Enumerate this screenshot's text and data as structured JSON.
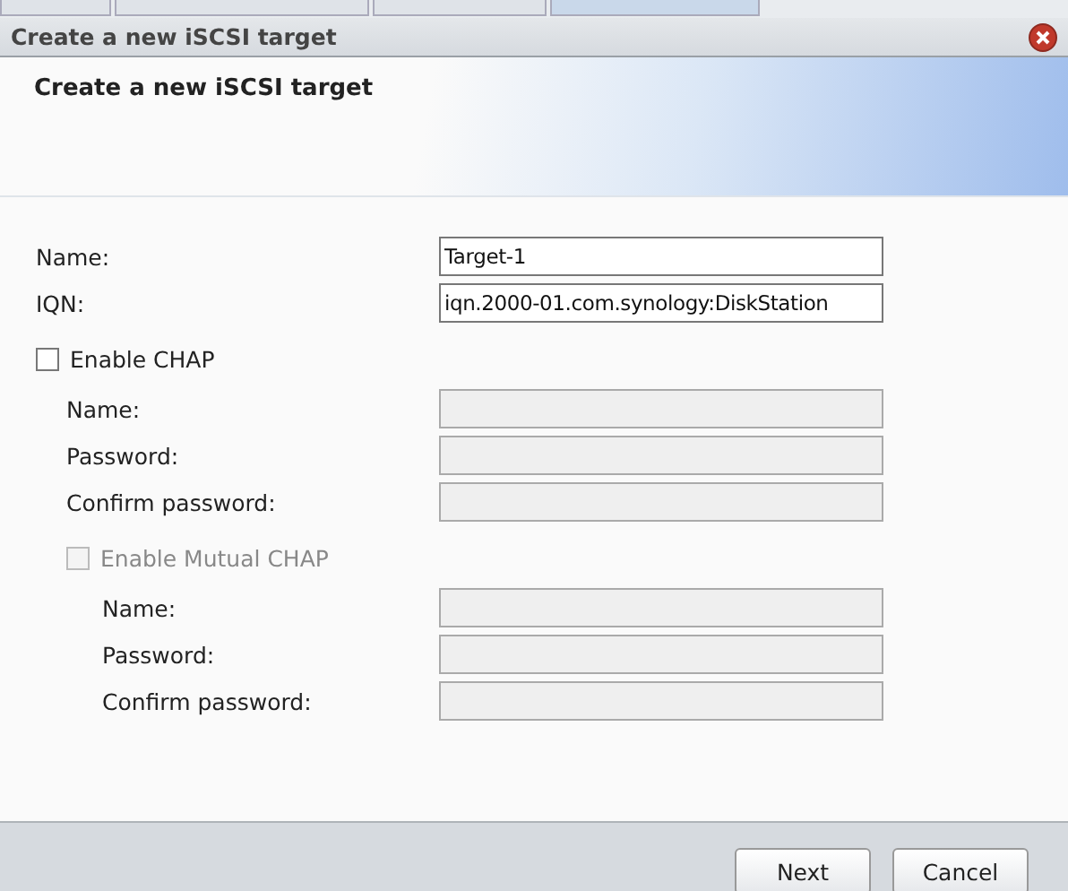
{
  "background_tabs": [
    {
      "selected": false
    },
    {
      "selected": false
    },
    {
      "selected": false
    },
    {
      "selected": true
    }
  ],
  "window": {
    "title": "Create a new iSCSI target"
  },
  "header": {
    "title": "Create a new iSCSI target"
  },
  "fields": [
    {
      "label": "Name:",
      "value": "Target-1",
      "disabled": false
    },
    {
      "label": "IQN:",
      "value": "iqn.2000-01.com.synology:DiskStation",
      "disabled": false
    }
  ],
  "chap": {
    "label": "Enable CHAP",
    "checked": false,
    "disabled": false,
    "fields": [
      {
        "label": "Name:",
        "disabled": true
      },
      {
        "label": "Password:",
        "disabled": true
      },
      {
        "label": "Confirm password:",
        "disabled": true
      }
    ],
    "mutual": {
      "label": "Enable Mutual CHAP",
      "checked": false,
      "disabled": true,
      "fields": [
        {
          "label": "Name:",
          "disabled": true
        },
        {
          "label": "Password:",
          "disabled": true
        },
        {
          "label": "Confirm password:",
          "disabled": true
        }
      ]
    }
  },
  "buttons": [
    {
      "label": "Next"
    },
    {
      "label": "Cancel"
    }
  ]
}
